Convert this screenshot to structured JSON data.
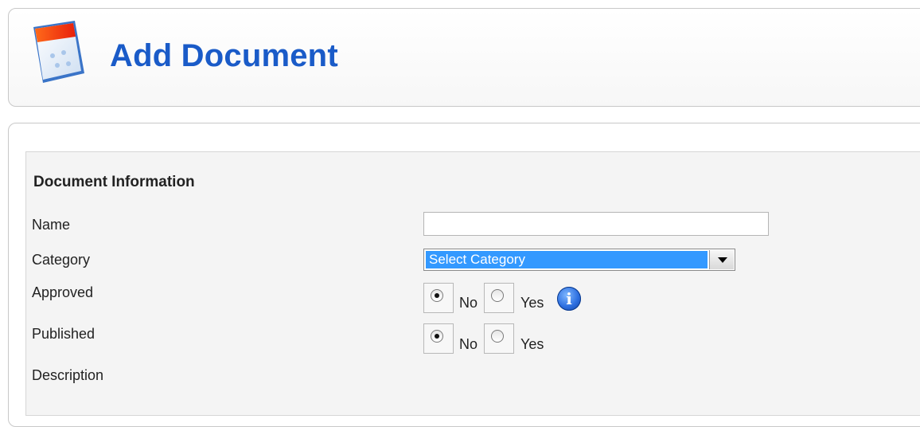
{
  "header": {
    "title": "Add Document",
    "icon": "document-add-icon"
  },
  "form": {
    "section_title": "Document Information",
    "name": {
      "label": "Name",
      "value": "",
      "placeholder": ""
    },
    "category": {
      "label": "Category",
      "selected": "Select Category"
    },
    "approved": {
      "label": "Approved",
      "no_label": "No",
      "yes_label": "Yes",
      "selected": "No",
      "info_icon": "info-icon",
      "info_glyph": "i"
    },
    "published": {
      "label": "Published",
      "no_label": "No",
      "yes_label": "Yes",
      "selected": "No"
    },
    "description": {
      "label": "Description"
    }
  },
  "colors": {
    "title": "#1a5bc8",
    "select_highlight": "#3399ff",
    "form_background": "#f4f4f4"
  }
}
